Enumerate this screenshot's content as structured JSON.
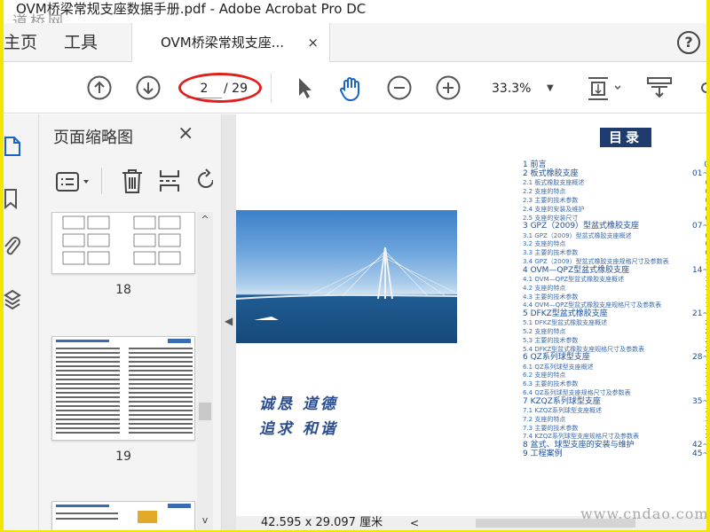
{
  "window": {
    "title": "OVM桥梁常规支座数据手册.pdf - Adobe Acrobat Pro DC",
    "watermark_top": "道桥网",
    "watermark_bottom": "www.cndao.com"
  },
  "tabs": {
    "home": "主页",
    "tools": "工具",
    "document": "OVM桥梁常规支座...",
    "close": "×",
    "help": "?"
  },
  "toolbar": {
    "current_page": "2",
    "total_pages": "/ 29",
    "zoom": "33.3%",
    "zoom_dropdown": "▼"
  },
  "thumbnail_panel": {
    "title": "页面缩略图",
    "close": "×",
    "pages": [
      "18",
      "19"
    ]
  },
  "document": {
    "slogan_line1": "诚恳  道德",
    "slogan_line2": "追求  和谐",
    "toc_title": "目录",
    "toc": [
      {
        "level": "h",
        "text": "1 前言",
        "page": "0"
      },
      {
        "level": "h",
        "text": "2 板式橡胶支座",
        "page": "01~"
      },
      {
        "level": "s",
        "text": "2.1 板式橡胶支座概述",
        "page": "0"
      },
      {
        "level": "s",
        "text": "2.2 支座的特点",
        "page": "0"
      },
      {
        "level": "s",
        "text": "2.3 主要的技术参数",
        "page": "0"
      },
      {
        "level": "s",
        "text": "2.4 支座的安装及维护",
        "page": "0"
      },
      {
        "level": "s",
        "text": "2.5 支座的安装尺寸",
        "page": "0"
      },
      {
        "level": "h",
        "text": "3 GPZ（2009）型盆式橡胶支座",
        "page": "07~"
      },
      {
        "level": "s",
        "text": "3.1 GPZ（2009）型盆式橡胶支座概述",
        "page": "0"
      },
      {
        "level": "s",
        "text": "3.2 支座的特点",
        "page": "0"
      },
      {
        "level": "s",
        "text": "3.3 主要的技术参数",
        "page": "0"
      },
      {
        "level": "s",
        "text": "3.4 GPZ（2009）型盆式橡胶支座规格尺寸及参数表",
        "page": "1"
      },
      {
        "level": "h",
        "text": "4 OVM—QPZ型盆式橡胶支座",
        "page": "14~"
      },
      {
        "level": "s",
        "text": "4.1 OVM—QPZ型盆式橡胶支座概述",
        "page": "1"
      },
      {
        "level": "s",
        "text": "4.2 支座的特点",
        "page": "1"
      },
      {
        "level": "s",
        "text": "4.3 主要的技术参数",
        "page": "1"
      },
      {
        "level": "s",
        "text": "4.4 OVM—QPZ型盆式橡胶支座规格尺寸及参数表",
        "page": "1"
      },
      {
        "level": "h",
        "text": "5 DFKZ型盆式橡胶支座",
        "page": "21~"
      },
      {
        "level": "s",
        "text": "5.1 DFKZ型盆式橡胶支座概述",
        "page": "2"
      },
      {
        "level": "s",
        "text": "5.2 支座的特点",
        "page": "2"
      },
      {
        "level": "s",
        "text": "5.3 主要的技术参数",
        "page": "2"
      },
      {
        "level": "s",
        "text": "5.4 DFKZ型盆式橡胶支座规格尺寸及参数表",
        "page": "2"
      },
      {
        "level": "h",
        "text": "6 QZ系列球型支座",
        "page": "28~"
      },
      {
        "level": "s",
        "text": "6.1 QZ系列球型支座概述",
        "page": "2"
      },
      {
        "level": "s",
        "text": "6.2 支座的特点",
        "page": "3"
      },
      {
        "level": "s",
        "text": "6.3 主要的技术参数",
        "page": "3"
      },
      {
        "level": "s",
        "text": "6.4 QZ系列球型支座规格尺寸及参数表",
        "page": "3"
      },
      {
        "level": "h",
        "text": "7 KZQZ系列球型支座",
        "page": "35~"
      },
      {
        "level": "s",
        "text": "7.1 KZQZ系列球型支座概述",
        "page": "3"
      },
      {
        "level": "s",
        "text": "7.2 支座的特点",
        "page": "3"
      },
      {
        "level": "s",
        "text": "7.3 主要的技术参数",
        "page": "3"
      },
      {
        "level": "s",
        "text": "7.4 KZQZ系列球型支座规格尺寸及参数表",
        "page": "3"
      },
      {
        "level": "h",
        "text": "8 盆式、球型支座的安装与维护",
        "page": "42~"
      },
      {
        "level": "h",
        "text": "9 工程案例",
        "page": "45~"
      }
    ]
  },
  "statusbar": {
    "dimensions": "42.595 x 29.097 厘米",
    "prev": "<"
  }
}
